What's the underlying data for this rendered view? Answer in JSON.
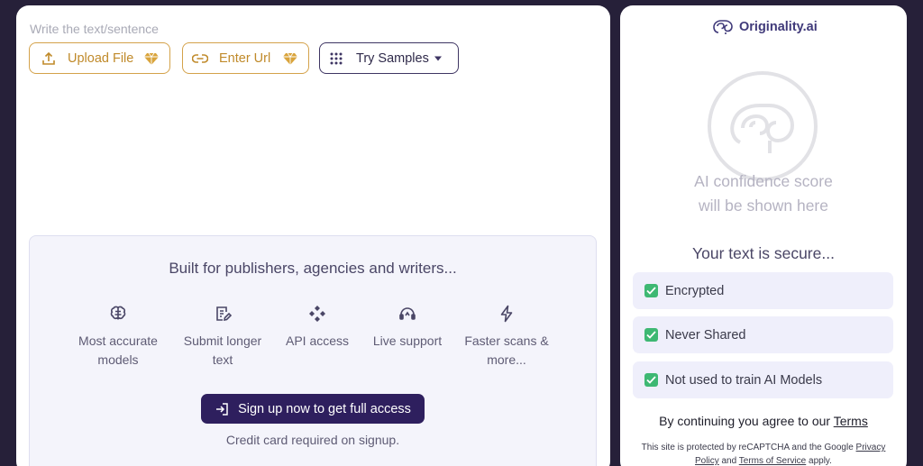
{
  "editor": {
    "placeholder": "Write the text/sentence",
    "upload_label": "Upload File",
    "url_label": "Enter Url",
    "samples_label": "Try Samples"
  },
  "promo": {
    "title": "Built for publishers, agencies and writers...",
    "features": [
      {
        "label_1": "Most accurate",
        "label_2": "models",
        "icon": "brain-icon"
      },
      {
        "label_1": "Submit longer",
        "label_2": "text",
        "icon": "document-edit-icon"
      },
      {
        "label_1": "API access",
        "label_2": "",
        "icon": "api-nodes-icon"
      },
      {
        "label_1": "Live support",
        "label_2": "",
        "icon": "headset-icon"
      },
      {
        "label_1": "Faster scans &",
        "label_2": "more...",
        "icon": "lightning-icon"
      }
    ],
    "signup_label": "Sign up now to get full access",
    "note": "Credit card required on signup."
  },
  "sidebar": {
    "brand": "Originality.ai",
    "score_line_1": "AI confidence score",
    "score_line_2": "will be shown here",
    "secure_title": "Your text is secure...",
    "secure_items": [
      "Encrypted",
      "Never Shared",
      "Not used to train AI Models"
    ],
    "agree_prefix": "By continuing you agree to our ",
    "terms_link": "Terms",
    "captcha_prefix": "This site is protected by reCAPTCHA and the Google ",
    "privacy_link": "Privacy Policy",
    "captcha_and": " and ",
    "tos_link": "Terms of Service",
    "captcha_suffix": " apply."
  },
  "colors": {
    "background": "#262039",
    "gold": "#c08a2a",
    "primary": "#2e1f5e",
    "check_green": "#3eb873",
    "brand_purple": "#403a7a"
  }
}
